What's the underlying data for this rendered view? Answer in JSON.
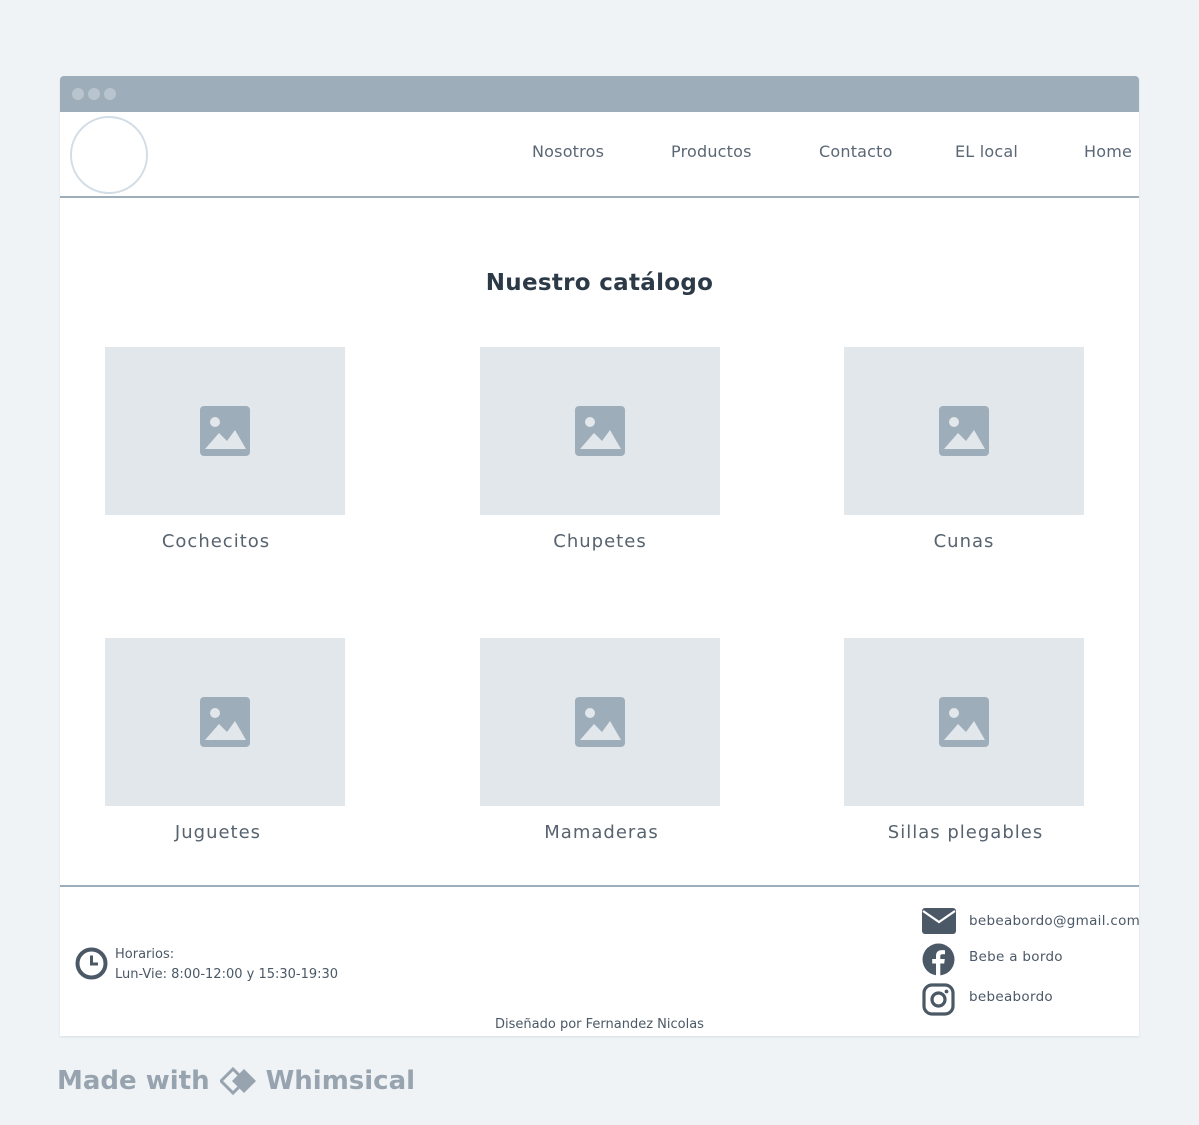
{
  "nav": {
    "items": [
      {
        "label": "Nosotros"
      },
      {
        "label": "Productos"
      },
      {
        "label": "Contacto"
      },
      {
        "label": "EL local"
      },
      {
        "label": "Home"
      }
    ]
  },
  "main": {
    "title": "Nuestro catálogo",
    "products": [
      {
        "label": "Cochecitos"
      },
      {
        "label": "Chupetes"
      },
      {
        "label": "Cunas"
      },
      {
        "label": "Juguetes"
      },
      {
        "label": "Mamaderas"
      },
      {
        "label": "Sillas plegables"
      }
    ]
  },
  "footer": {
    "hours_title": "Horarios:",
    "hours_detail": "Lun-Vie: 8:00-12:00 y 15:30-19:30",
    "email": "bebeabordo@gmail.com",
    "facebook": "Bebe a bordo",
    "instagram": "bebeabordo",
    "credit": "Diseñado por Fernandez Nicolas"
  },
  "watermark": {
    "prefix": "Made with",
    "brand": "Whimsical"
  },
  "colors": {
    "chrome": "#9eadba",
    "placeholder": "#e2e7eb",
    "icon": "#4b5866",
    "title": "#2c3a48"
  }
}
